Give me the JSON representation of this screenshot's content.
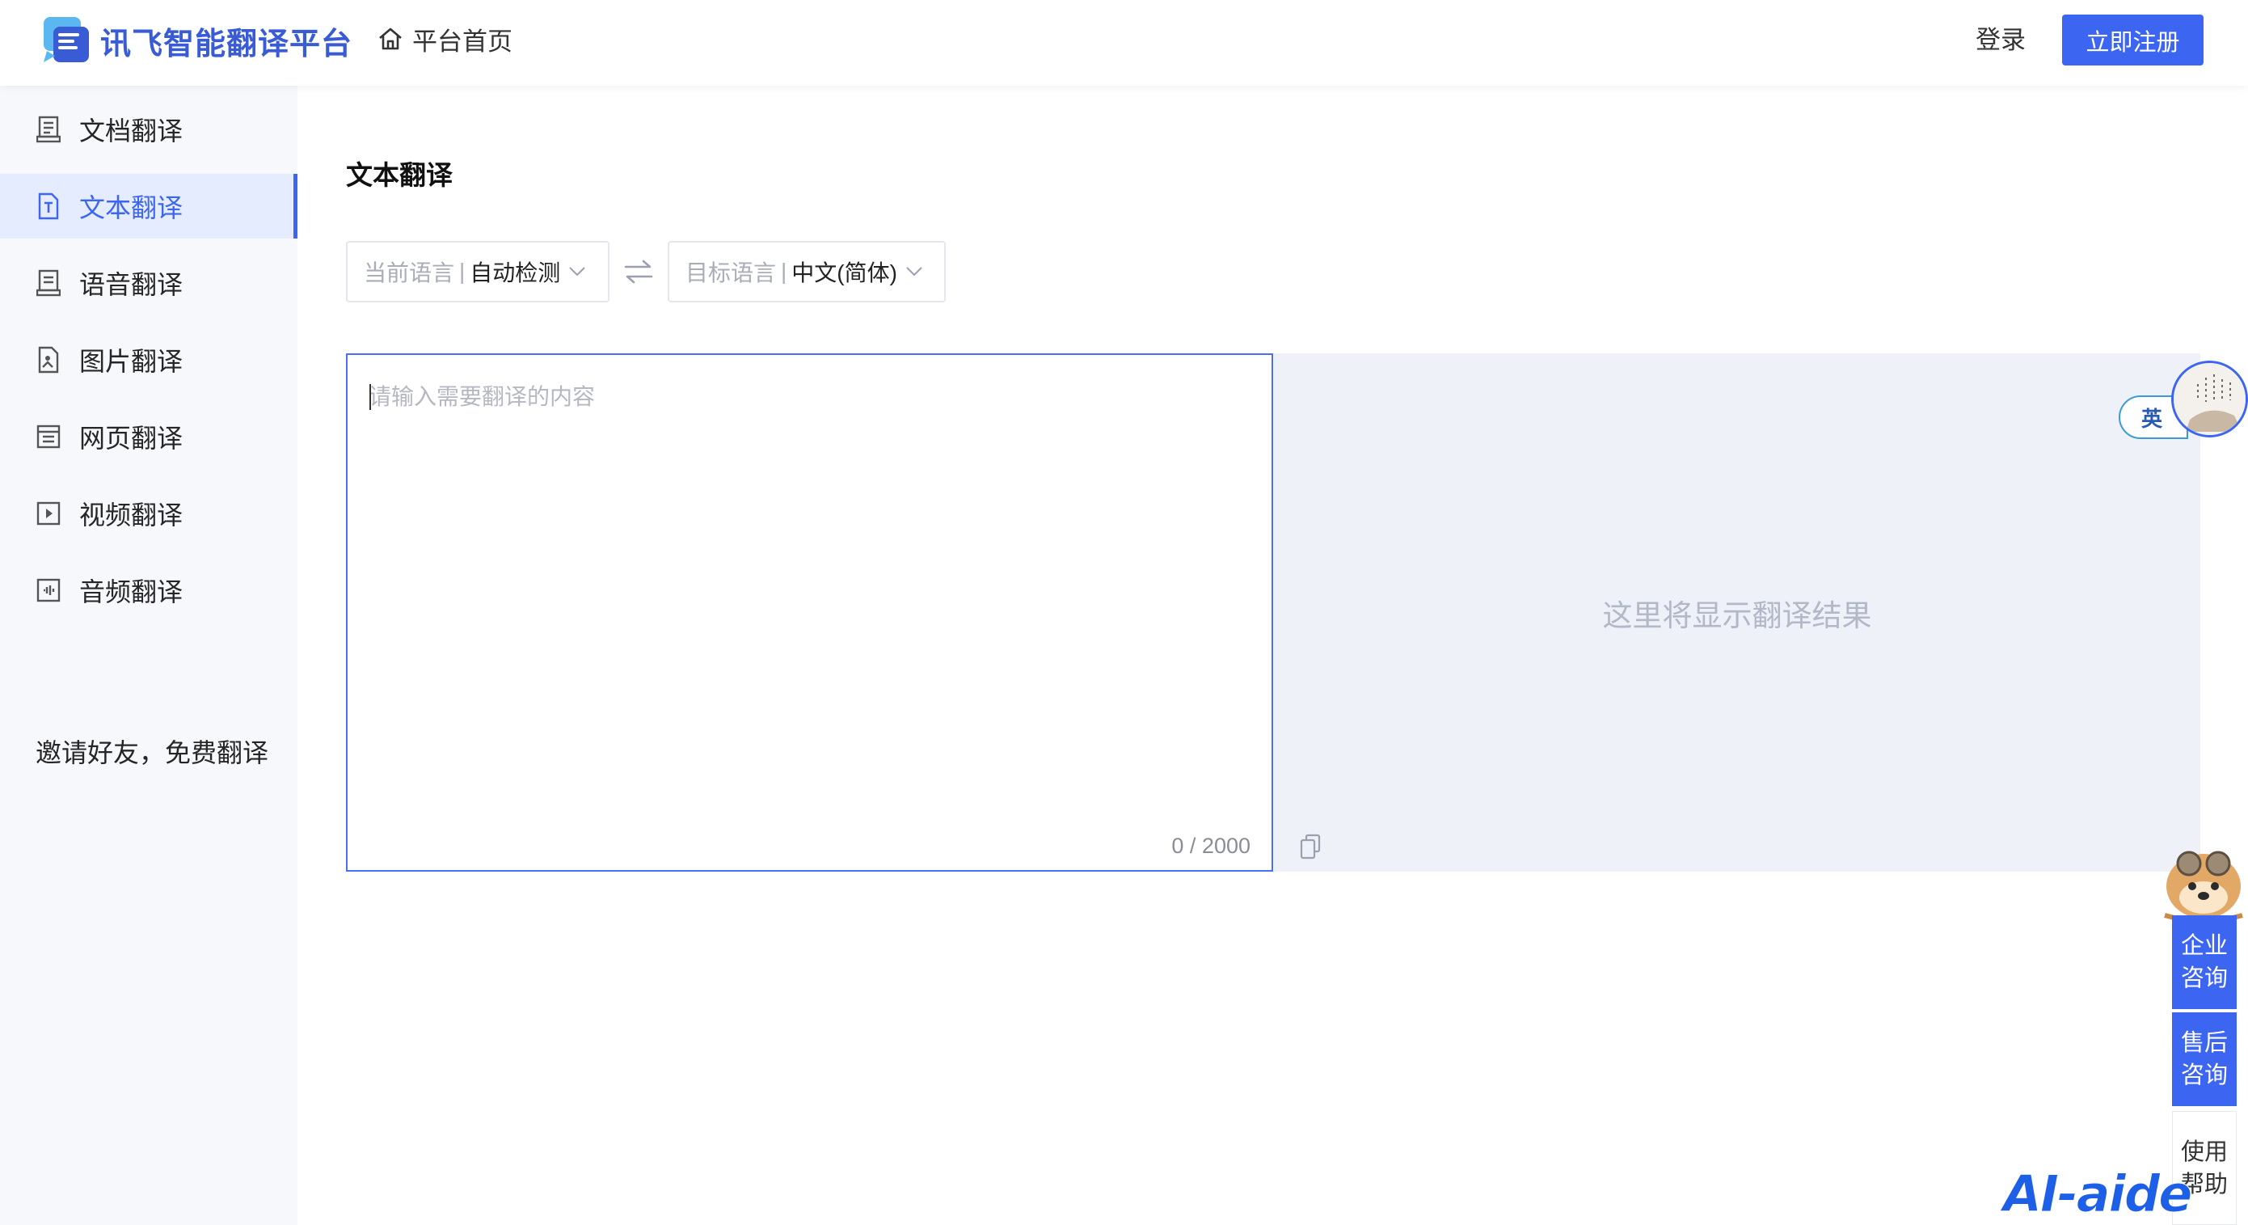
{
  "header": {
    "logo_text": "讯飞智能翻译平台",
    "home_label": "平台首页",
    "login_label": "登录",
    "register_label": "立即注册"
  },
  "sidebar": {
    "items": [
      {
        "label": "文档翻译",
        "icon": "document-icon",
        "active": false
      },
      {
        "label": "文本翻译",
        "icon": "text-file-icon",
        "active": true
      },
      {
        "label": "语音翻译",
        "icon": "voice-icon",
        "active": false
      },
      {
        "label": "图片翻译",
        "icon": "image-icon",
        "active": false
      },
      {
        "label": "网页翻译",
        "icon": "webpage-icon",
        "active": false
      },
      {
        "label": "视频翻译",
        "icon": "video-icon",
        "active": false
      },
      {
        "label": "音频翻译",
        "icon": "audio-icon",
        "active": false
      }
    ],
    "invite_label": "邀请好友，免费翻译"
  },
  "main": {
    "title": "文本翻译",
    "source_lang": {
      "label": "当前语言",
      "separator": "|",
      "value": "自动检测"
    },
    "target_lang": {
      "label": "目标语言",
      "separator": "|",
      "value": "中文(简体)"
    },
    "input": {
      "placeholder": "请输入需要翻译的内容",
      "value": "",
      "char_count": "0 / 2000"
    },
    "output": {
      "placeholder": "这里将显示翻译结果"
    }
  },
  "floating": {
    "lang_pill": "英",
    "enterprise": [
      "企业",
      "咨询"
    ],
    "aftersale": [
      "售后",
      "咨询"
    ],
    "help": [
      "使用",
      "帮助"
    ],
    "watermark": "AI-aide"
  },
  "colors": {
    "accent": "#3c66f2",
    "sidebar_bg": "#f6f8fc",
    "active_bg": "#e5ecfd",
    "output_bg": "#eef1f8"
  }
}
